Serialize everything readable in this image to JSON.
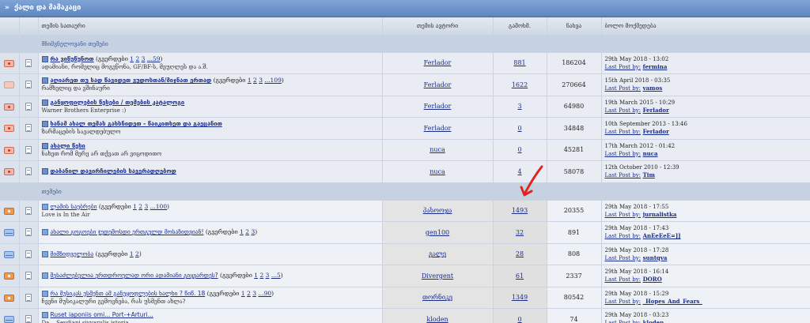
{
  "forum": {
    "title": "ქალი და მამაკაცი",
    "arrow": "»"
  },
  "columns": {
    "title": "თემის სათაური",
    "author": "თემის ავტორი",
    "replies": "გამოხმ.",
    "views": "ნახვა",
    "last": "ბოლო მოქმედება"
  },
  "sections": {
    "pinned": "მნიშვნელოვანი თემები",
    "topics": "თემები"
  },
  "last_post_label": "Last Post by:",
  "pinned_topics": [
    {
      "status": "red",
      "title": "რა ვიწუწუნოთ",
      "pages_prefix": "(გვერდები",
      "pages": [
        "1",
        "2",
        "3",
        "...59"
      ],
      "desc": "ადამიანი, რომელიც მოგეწონა, GF/BF-ს, მეუღლეს და ა.შ.",
      "author": "Ferlador",
      "replies": "881",
      "views": "186204",
      "date": "29th May 2018 - 13:02",
      "user": "fermina"
    },
    {
      "status": "pink",
      "title": "აღიარეთ თუ სად წავიდეთ ვუდოსთან/მიჯნათ ერთად",
      "pages_prefix": "(გვერდები",
      "pages": [
        "1",
        "2",
        "3",
        "...109"
      ],
      "desc": "რამხელიც და ვშინაური",
      "author": "Ferlador",
      "replies": "1622",
      "views": "270664",
      "date": "15th April 2018 - 03:35",
      "user": "vamos"
    },
    {
      "status": "red",
      "title": "განყოფილების წესები / თემების კატალოგი",
      "pages_prefix": "",
      "pages": [],
      "desc": "Warner Brothers Enterprise :)",
      "author": "Ferlador",
      "replies": "3",
      "views": "64980",
      "date": "19th March 2015 - 10:29",
      "user": "Ferlador"
    },
    {
      "status": "red",
      "title": "ხანამ ახალ თემას გახსნიდეთ - წაიკითხეთ და გაეცანით",
      "pages_prefix": "",
      "pages": [],
      "desc": "ზარმაცების სავალდებულო",
      "author": "Ferlador",
      "replies": "0",
      "views": "34848",
      "date": "10th September 2013 - 13:46",
      "user": "Ferlador"
    },
    {
      "status": "red",
      "title": "ახალი წესი",
      "pages_prefix": "",
      "pages": [],
      "desc": "ნახეთ რომ მერე არ თქვათ არ ვიცოდითო",
      "author": "nuca",
      "replies": "0",
      "views": "45281",
      "date": "17th March 2012 - 01:42",
      "user": "nuca"
    },
    {
      "status": "red",
      "title": "დაბანილ დავირჩილების სავერადღებოდ",
      "pages_prefix": "",
      "pages": [],
      "desc": "",
      "author": "nuca",
      "replies": "4",
      "views": "58078",
      "date": "12th October 2010 - 12:39",
      "user": "Tim"
    }
  ],
  "topics": [
    {
      "status": "orange",
      "title": "ლამის საუბრები",
      "pages_prefix": "(გვერდები",
      "pages": [
        "1",
        "2",
        "3",
        "...100"
      ],
      "desc": "Love is In the Air",
      "author": "ჰასოოჯა",
      "replies": "1493",
      "views": "20355",
      "date": "29th May 2018 - 17:55",
      "user": "jurnalistka"
    },
    {
      "status": "blue",
      "title": "ახალი გოგოები ჯუდემოსდი ერთგულდ მოსაზიდვიან!",
      "pages_prefix": "(გვერდები",
      "pages": [
        "1",
        "2",
        "3"
      ],
      "desc": "",
      "author": "gen100",
      "replies": "32",
      "views": "891",
      "date": "29th May 2018 - 17:43",
      "user": "AnEeEeE=]]"
    },
    {
      "status": "blue",
      "title": "მიმზიდველობა",
      "pages_prefix": "(გვერდები",
      "pages": [
        "1",
        "2"
      ],
      "desc": "",
      "author": "გალე",
      "replies": "28",
      "views": "808",
      "date": "29th May 2018 - 17:28",
      "user": "suntqva"
    },
    {
      "status": "orange",
      "title": "შესაძლებელია ერთდროულად ორი ადამიანი გიყვარდეს?",
      "pages_prefix": "(გვერდები",
      "pages": [
        "1",
        "2",
        "3",
        "...5"
      ],
      "desc": "",
      "author": "Divergent",
      "replies": "61",
      "views": "2337",
      "date": "29th May 2018 - 16:14",
      "user": "DORO"
    },
    {
      "status": "orange",
      "title": "რა მუსიკას უსმენთ ამ განუყოფლების ხალხი ? წიწ. 18",
      "pages_prefix": "(გვერდები",
      "pages": [
        "1",
        "2",
        "3",
        "...90"
      ],
      "desc": "ჩვენი მუსიკალური გემოვნება, რას უსმენთ ახლა?",
      "author": "თორნიკე",
      "replies": "1349",
      "views": "80542",
      "date": "29th May 2018 - 15:29",
      "user": "_Hopes_And_Fears_"
    },
    {
      "status": "blue",
      "title": "Ruset iaponiis omi... Port-+Arturi...",
      "pages_prefix": "",
      "pages": [],
      "desc": "Da... Sevdiani siyvarulis istoria...",
      "author": "kloden",
      "replies": "0",
      "views": "74",
      "date": "29th May 2018 - 03:23",
      "user": "kloden"
    }
  ]
}
